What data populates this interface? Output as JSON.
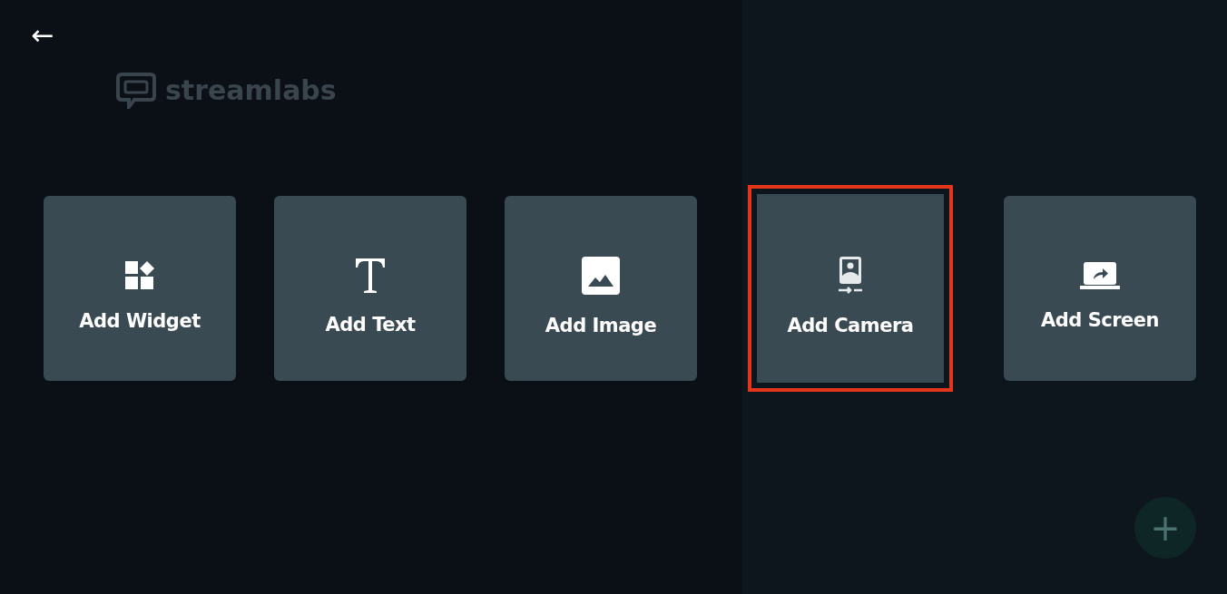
{
  "back_button": {
    "label": "←"
  },
  "logo": {
    "text": "streamlabs"
  },
  "source_cards": [
    {
      "label": "Add Widget",
      "kind": "widget",
      "highlighted": false
    },
    {
      "label": "Add Text",
      "kind": "text",
      "highlighted": false
    },
    {
      "label": "Add Image",
      "kind": "image",
      "highlighted": false
    },
    {
      "label": "Add Camera",
      "kind": "camera",
      "highlighted": true
    },
    {
      "label": "Add Screen",
      "kind": "screen",
      "highlighted": false
    }
  ],
  "fab": {
    "label": "+"
  }
}
